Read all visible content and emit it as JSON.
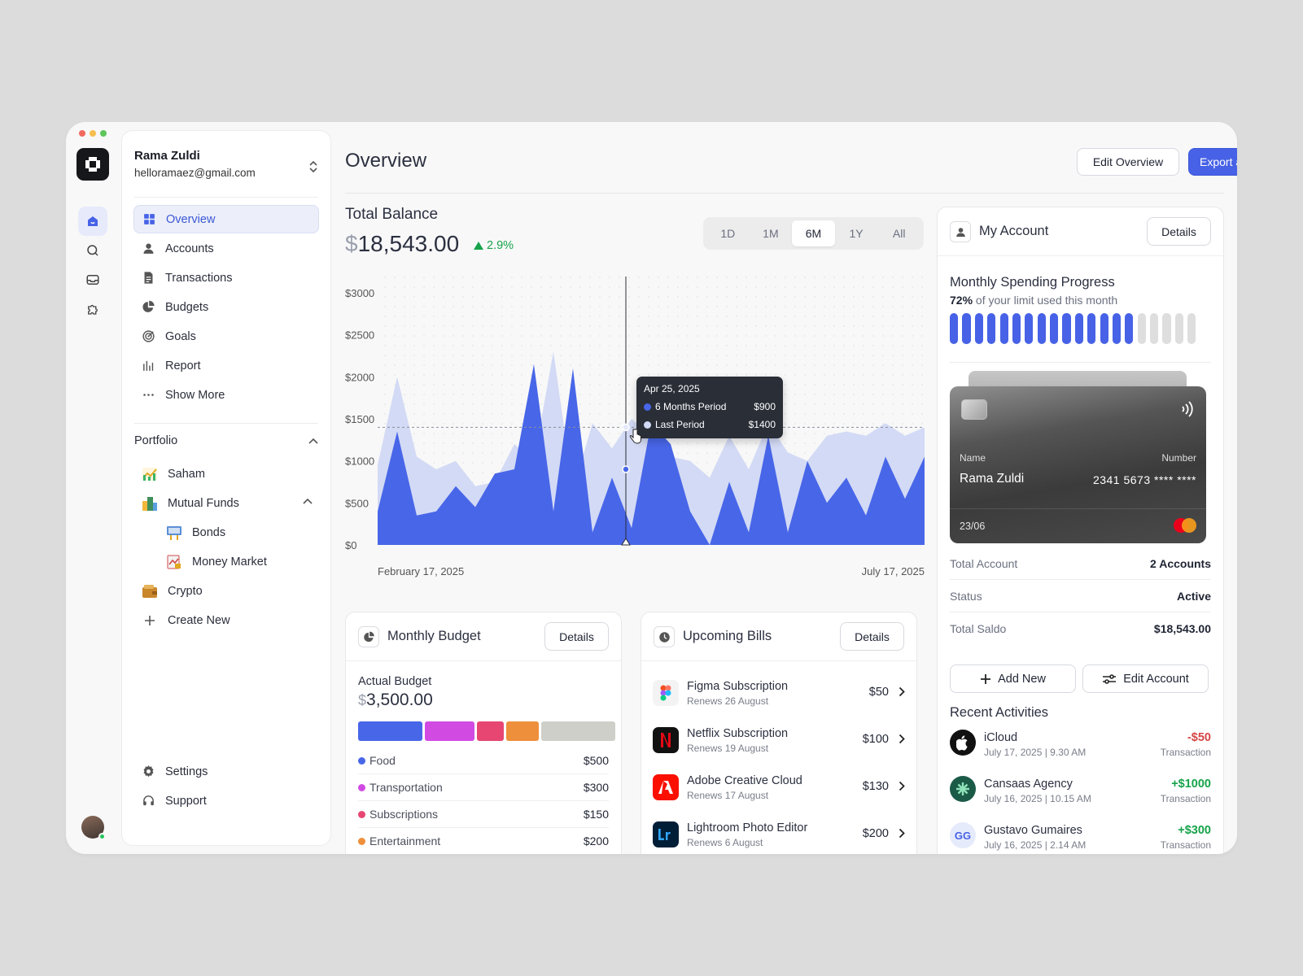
{
  "user": {
    "name": "Rama Zuldi",
    "email": "helloramaez@gmail.com"
  },
  "nav": [
    {
      "label": "Overview",
      "icon": "grid-icon",
      "active": true
    },
    {
      "label": "Accounts",
      "icon": "user-icon"
    },
    {
      "label": "Transactions",
      "icon": "document-icon"
    },
    {
      "label": "Budgets",
      "icon": "pie-icon"
    },
    {
      "label": "Goals",
      "icon": "target-icon"
    },
    {
      "label": "Report",
      "icon": "bar-chart-icon"
    },
    {
      "label": "Show More",
      "icon": "more-icon"
    }
  ],
  "portfolio": {
    "title": "Portfolio",
    "items": [
      {
        "label": "Saham"
      },
      {
        "label": "Mutual Funds"
      },
      {
        "label": "Bonds"
      },
      {
        "label": "Money Market"
      },
      {
        "label": "Crypto"
      },
      {
        "label": "Create New"
      }
    ]
  },
  "bottom_nav": [
    {
      "label": "Settings",
      "icon": "gear-icon"
    },
    {
      "label": "Support",
      "icon": "headset-icon"
    }
  ],
  "header": {
    "title": "Overview",
    "edit_label": "Edit Overview",
    "export_label": "Export as"
  },
  "balance": {
    "label": "Total Balance",
    "currency": "$",
    "amount": "18,543.00",
    "change": "2.9%",
    "change_color": "#16a34a",
    "periods": [
      "1D",
      "1M",
      "6M",
      "1Y",
      "All"
    ],
    "active_period": "6M"
  },
  "chart_data": {
    "type": "area",
    "x_start_label": "February 17, 2025",
    "x_end_label": "July 17, 2025",
    "y_ticks": [
      "$3000",
      "$2500",
      "$2000",
      "$1500",
      "$1000",
      "$500",
      "$0"
    ],
    "ylim": [
      0,
      3000
    ],
    "series": [
      {
        "name": "6 Months Period",
        "color": "#4866e8",
        "values": [
          400,
          1350,
          350,
          400,
          700,
          450,
          850,
          900,
          2150,
          400,
          2100,
          150,
          800,
          200,
          1450,
          1200,
          400,
          0,
          750,
          150,
          1300,
          150,
          1000,
          500,
          800,
          350,
          1050,
          550,
          1050
        ]
      },
      {
        "name": "Last Period",
        "color": "#d3daf5",
        "values": [
          950,
          2000,
          1050,
          900,
          1000,
          700,
          750,
          1200,
          1000,
          2300,
          650,
          1450,
          1150,
          1500,
          1300,
          1050,
          1000,
          800,
          1300,
          900,
          1450,
          1100,
          1000,
          1300,
          1350,
          1300,
          1450,
          1300,
          1400
        ]
      }
    ],
    "reference_value": 1400,
    "tooltip": {
      "date": "Apr 25, 2025",
      "rows": [
        {
          "label": "6 Months Period",
          "value": "$900",
          "color": "#4866e8"
        },
        {
          "label": "Last Period",
          "value": "$1400",
          "color": "#d3daf5"
        }
      ]
    }
  },
  "monthly_budget": {
    "title": "Monthly Budget",
    "details_label": "Details",
    "actual_label": "Actual Budget",
    "currency": "$",
    "amount": "3,500.00",
    "segments": [
      {
        "color": "#4866e8",
        "share": 0.26
      },
      {
        "color": "#d14be3",
        "share": 0.2
      },
      {
        "color": "#e74673",
        "share": 0.11
      },
      {
        "color": "#ee8f3c",
        "share": 0.13
      },
      {
        "color": "#cfcfca",
        "share": 0.3
      }
    ],
    "items": [
      {
        "label": "Food",
        "amount": "$500",
        "color": "#4866e8"
      },
      {
        "label": "Transportation",
        "amount": "$300",
        "color": "#d14be3"
      },
      {
        "label": "Subscriptions",
        "amount": "$150",
        "color": "#e74673"
      },
      {
        "label": "Entertainment",
        "amount": "$200",
        "color": "#ee8f3c"
      }
    ]
  },
  "upcoming_bills": {
    "title": "Upcoming Bills",
    "details_label": "Details",
    "items": [
      {
        "name": "Figma Subscription",
        "renews": "Renews 26 August",
        "amount": "$50",
        "logo": "figma-logo"
      },
      {
        "name": "Netflix Subscription",
        "renews": "Renews 19 August",
        "amount": "$100",
        "logo": "netflix-logo"
      },
      {
        "name": "Adobe Creative Cloud",
        "renews": "Renews 17 August",
        "amount": "$130",
        "logo": "adobe-logo"
      },
      {
        "name": "Lightroom Photo Editor",
        "renews": "Renews 6 August",
        "amount": "$200",
        "logo": "lightroom-logo"
      }
    ]
  },
  "account": {
    "title": "My Account",
    "details_label": "Details",
    "progress_title": "Monthly Spending Progress",
    "progress_percent": "72%",
    "progress_text": "of your limit used this month",
    "segments_total": 20,
    "segments_filled": 15,
    "card": {
      "name_label": "Name",
      "number_label": "Number",
      "holder": "Rama Zuldi",
      "number": "2341  5673 **** ****",
      "expiry": "23/06"
    },
    "info": [
      {
        "label": "Total Account",
        "value": "2 Accounts"
      },
      {
        "label": "Status",
        "value": "Active"
      },
      {
        "label": "Total Saldo",
        "value": "$18,543.00"
      }
    ],
    "add_label": "Add New",
    "edit_label": "Edit Account",
    "recent_title": "Recent Activities",
    "activities": [
      {
        "name": "iCloud",
        "date": "July 17, 2025 | 9.30 AM",
        "amount": "-$50",
        "type": "Transaction",
        "amount_color": "#d64545"
      },
      {
        "name": "Cansaas Agency",
        "date": "July 16, 2025 | 10.15 AM",
        "amount": "+$1000",
        "type": "Transaction",
        "amount_color": "#16a34a"
      },
      {
        "name": "Gustavo Gumaires",
        "date": "July 16, 2025 | 2.14 AM",
        "amount": "+$300",
        "type": "Transaction",
        "amount_color": "#16a34a",
        "initials": "GG"
      }
    ]
  }
}
